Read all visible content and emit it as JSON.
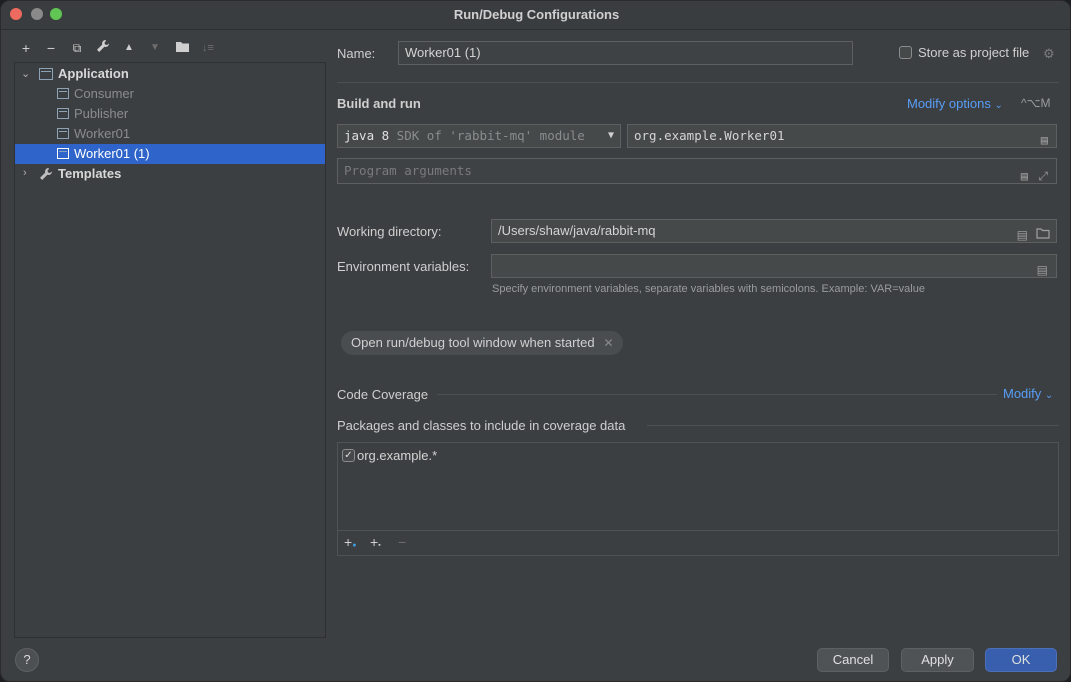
{
  "window": {
    "title": "Run/Debug Configurations"
  },
  "toolbar": {
    "add": "+",
    "remove": "−",
    "copy": "⧉",
    "edit": "🔧",
    "up": "▲",
    "down": "▼",
    "folder": "▰",
    "sort": "↓≡"
  },
  "tree": {
    "application_label": "Application",
    "items": [
      {
        "label": "Consumer"
      },
      {
        "label": "Publisher"
      },
      {
        "label": "Worker01"
      },
      {
        "label": "Worker01 (1)"
      }
    ],
    "templates_label": "Templates"
  },
  "form": {
    "name_label": "Name:",
    "name_value": "Worker01 (1)",
    "store_label": "Store as project file",
    "build_run_heading": "Build and run",
    "modify_options": "Modify options",
    "modify_shortcut": "^⌥M",
    "jdk_bold": "java 8",
    "jdk_rest": " SDK of 'rabbit-mq' module",
    "main_class": "org.example.Worker01",
    "program_args_placeholder": "Program arguments",
    "working_dir_label": "Working directory:",
    "working_dir_value": "/Users/shaw/java/rabbit-mq",
    "env_label": "Environment variables:",
    "env_value": "",
    "env_hint": "Specify environment variables, separate variables with semicolons. Example: VAR=value",
    "chip_label": "Open run/debug tool window when started",
    "coverage_heading": "Code Coverage",
    "coverage_modify": "Modify",
    "packages_label": "Packages and classes to include in coverage data",
    "packages": [
      {
        "name": "org.example.*",
        "checked": true
      }
    ]
  },
  "buttons": {
    "help": "?",
    "cancel": "Cancel",
    "apply": "Apply",
    "ok": "OK"
  },
  "colors": {
    "accent": "#589df6",
    "selection": "#2f65ca",
    "primary_button": "#375fad"
  }
}
